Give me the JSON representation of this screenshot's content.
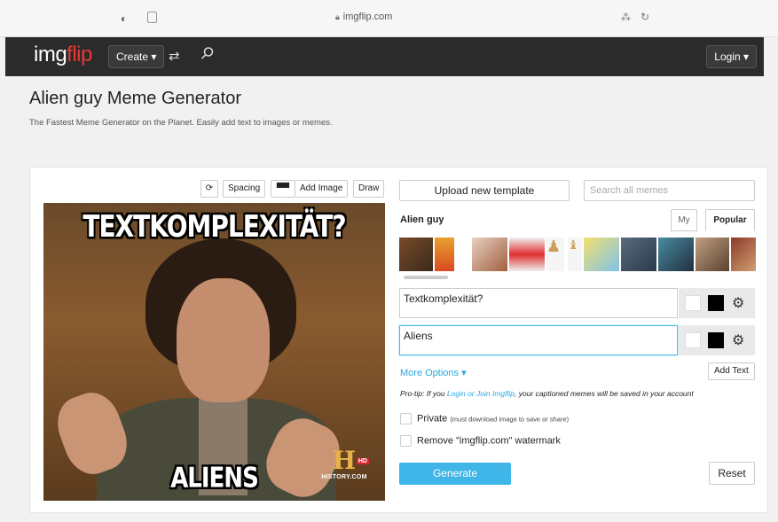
{
  "browser": {
    "url": "imgflip.com",
    "icons": [
      "shield-icon",
      "reader-icon",
      "lock-icon",
      "translate-icon",
      "reload-icon"
    ]
  },
  "nav": {
    "logo_img": "img",
    "logo_flip": "flip",
    "create_label": "Create ▾",
    "login_label": "Login ▾",
    "icons": [
      "shuffle-icon",
      "search-icon"
    ]
  },
  "page": {
    "title": "Alien guy Meme Generator",
    "subtitle": "The Fastest Meme Generator on the Planet. Easily add text to images or memes."
  },
  "toolbar": {
    "spacing_label": "Spacing",
    "add_image_label": "Add Image",
    "draw_label": "Draw"
  },
  "meme": {
    "top_text": "TEXTKOMPLEXITÄT?",
    "bottom_text": "ALIENS",
    "channel_logo": "H",
    "channel_hd": "HD",
    "channel_text": "HISTORY.COM"
  },
  "side": {
    "upload_label": "Upload new template",
    "search_placeholder": "Search all memes",
    "template_name": "Alien guy",
    "tab_my": "My",
    "tab_popular": "Popular"
  },
  "text_boxes": [
    {
      "value": "Textkomplexität?"
    },
    {
      "value": "Aliens"
    }
  ],
  "options": {
    "more_options_label": "More Options ▾",
    "add_text_label": "Add Text",
    "protip_prefix": "Pro-tip: If you ",
    "protip_link": "Login or Join Imgflip",
    "protip_suffix": ", your captioned memes will be saved in your account",
    "private_label": "Private",
    "private_note": "(must download image to save or share)",
    "watermark_label": "Remove \"imgflip.com\" watermark",
    "generate_label": "Generate",
    "reset_label": "Reset"
  },
  "colors": {
    "accent": "#3fb5e8",
    "nav_bg": "#2b2b2b",
    "logo_red": "#e93838"
  }
}
